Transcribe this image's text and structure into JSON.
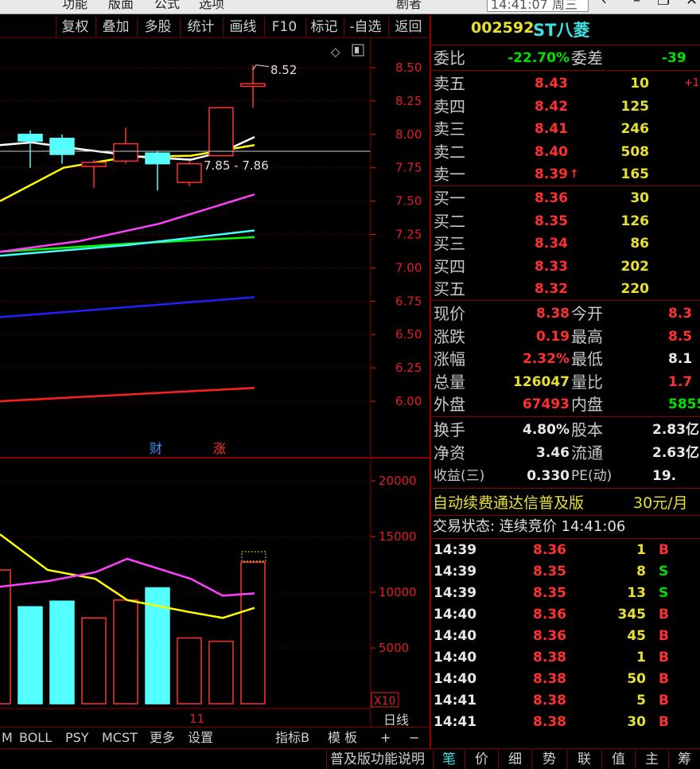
{
  "topbar": {
    "menus": [
      "功能",
      "版面",
      "公式",
      "选项"
    ],
    "clock": "14:41:07 周三",
    "extra": "剧者"
  },
  "toolbar": {
    "buttons": [
      "复权",
      "叠加",
      "多股",
      "统计",
      "画线",
      "F10",
      "标记",
      "-自选",
      "返回"
    ]
  },
  "chart": {
    "price_ticks": [
      "8.50",
      "8.25",
      "8.00",
      "7.75",
      "7.50",
      "7.25",
      "7.00",
      "6.75",
      "6.50",
      "6.25",
      "6.00"
    ],
    "vol_ticks": [
      "20000",
      "15000",
      "10000",
      "5000"
    ],
    "high_label": "8.52",
    "range_label": "7.85 - 7.86",
    "badge_cai": "财",
    "badge_zhang": "涨",
    "x10": "X10",
    "date_label": "11",
    "rixian": "日线",
    "colors": {
      "ma5": "#ffffff",
      "ma10": "#ffff00",
      "ma20": "#ff40ff",
      "ma30": "#00ff00",
      "ma60": "#40ffff",
      "ma120": "#2020ff",
      "ma250": "#ff2020",
      "up": "#ff3030",
      "down": "#54ffff"
    }
  },
  "chart_data": {
    "type": "candlestick",
    "price_axis": [
      6.0,
      8.5
    ],
    "candles": [
      {
        "o": 7.95,
        "c": 8.0,
        "h": 8.03,
        "l": 7.75,
        "dir": "down"
      },
      {
        "o": 7.97,
        "c": 7.85,
        "h": 8.0,
        "l": 7.78,
        "dir": "down"
      },
      {
        "o": 7.76,
        "c": 7.79,
        "h": 7.81,
        "l": 7.6,
        "dir": "up"
      },
      {
        "o": 7.8,
        "c": 7.93,
        "h": 8.05,
        "l": 7.78,
        "dir": "up"
      },
      {
        "o": 7.86,
        "c": 7.78,
        "h": 7.87,
        "l": 7.58,
        "dir": "down"
      },
      {
        "o": 7.64,
        "c": 7.78,
        "h": 7.8,
        "l": 7.61,
        "dir": "up"
      },
      {
        "o": 7.84,
        "c": 8.2,
        "h": 8.2,
        "l": 7.84,
        "dir": "up"
      },
      {
        "o": 8.36,
        "c": 8.38,
        "h": 8.52,
        "l": 8.2,
        "dir": "up"
      }
    ],
    "volumes": [
      {
        "v": 12000,
        "dir": "up"
      },
      {
        "v": 8700,
        "dir": "down"
      },
      {
        "v": 9200,
        "dir": "down"
      },
      {
        "v": 7700,
        "dir": "up"
      },
      {
        "v": 9300,
        "dir": "up"
      },
      {
        "v": 10400,
        "dir": "down"
      },
      {
        "v": 5900,
        "dir": "up"
      },
      {
        "v": 5600,
        "dir": "up"
      },
      {
        "v": 12700,
        "dir": "up"
      }
    ],
    "vol_axis": [
      0,
      20000
    ]
  },
  "quote": {
    "code": "002592",
    "name": "ST八菱",
    "weibi_label": "委比",
    "weibi": "-22.70%",
    "weicha_label": "委差",
    "weicha": "-39",
    "sells": [
      {
        "label": "卖五",
        "price": "8.43",
        "vol": "10",
        "chg": "+1"
      },
      {
        "label": "卖四",
        "price": "8.42",
        "vol": "125",
        "chg": ""
      },
      {
        "label": "卖三",
        "price": "8.41",
        "vol": "246",
        "chg": ""
      },
      {
        "label": "卖二",
        "price": "8.40",
        "vol": "508",
        "chg": ""
      },
      {
        "label": "卖一",
        "price": "8.39",
        "vol": "165",
        "chg": ""
      }
    ],
    "buys": [
      {
        "label": "买一",
        "price": "8.36",
        "vol": "30"
      },
      {
        "label": "买二",
        "price": "8.35",
        "vol": "126"
      },
      {
        "label": "买三",
        "price": "8.34",
        "vol": "86"
      },
      {
        "label": "买四",
        "price": "8.33",
        "vol": "202"
      },
      {
        "label": "买五",
        "price": "8.32",
        "vol": "220"
      }
    ],
    "stats": [
      {
        "l1": "现价",
        "v1": "8.38",
        "c1": "red",
        "l2": "今开",
        "v2": "8.3",
        "c2": "red"
      },
      {
        "l1": "涨跌",
        "v1": "0.19",
        "c1": "red",
        "l2": "最高",
        "v2": "8.5",
        "c2": "red"
      },
      {
        "l1": "涨幅",
        "v1": "2.32%",
        "c1": "red",
        "l2": "最低",
        "v2": "8.1",
        "c2": "white"
      },
      {
        "l1": "总量",
        "v1": "126047",
        "c1": "yellow",
        "l2": "量比",
        "v2": "1.7",
        "c2": "red"
      },
      {
        "l1": "外盘",
        "v1": "67493",
        "c1": "red",
        "l2": "内盘",
        "v2": "5855",
        "c2": "green"
      }
    ],
    "stats2": [
      {
        "l1": "换手",
        "v1": "4.80%",
        "l2": "股本",
        "v2": "2.83亿"
      },
      {
        "l1": "净资",
        "v1": "3.46",
        "l2": "流通",
        "v2": "2.63亿"
      },
      {
        "l1": "收益(三)",
        "v1": "0.330",
        "l2": "PE(动)",
        "v2": "19."
      }
    ],
    "promo": "自动续费通达信普及版",
    "promo_price": "30元/月",
    "trade_status": "交易状态: 连续竞价 14:41:06",
    "ticks": [
      {
        "t": "14:39",
        "p": "8.36",
        "v": "1",
        "bs": "B"
      },
      {
        "t": "14:39",
        "p": "8.35",
        "v": "8",
        "bs": "S"
      },
      {
        "t": "14:39",
        "p": "8.35",
        "v": "13",
        "bs": "S"
      },
      {
        "t": "14:40",
        "p": "8.36",
        "v": "345",
        "bs": "B"
      },
      {
        "t": "14:40",
        "p": "8.36",
        "v": "45",
        "bs": "B"
      },
      {
        "t": "14:40",
        "p": "8.38",
        "v": "1",
        "bs": "B"
      },
      {
        "t": "14:40",
        "p": "8.38",
        "v": "50",
        "bs": "B"
      },
      {
        "t": "14:41",
        "p": "8.38",
        "v": "5",
        "bs": "B"
      },
      {
        "t": "14:41",
        "p": "8.38",
        "v": "30",
        "bs": "B"
      }
    ]
  },
  "ind_tabs": [
    "M",
    "BOLL",
    "PSY",
    "MCST",
    "更多",
    "设置",
    "指标B",
    "模 板",
    "+",
    "−"
  ],
  "bottom_tabs": {
    "help": "普及版功能说明",
    "tabs": [
      "笔",
      "价",
      "细",
      "势",
      "联",
      "值",
      "主",
      "筹"
    ]
  }
}
